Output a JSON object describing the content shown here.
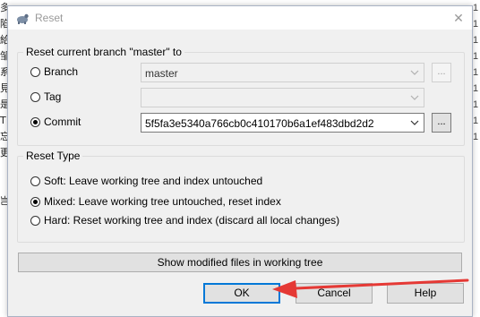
{
  "dialog": {
    "title": "Reset",
    "close_glyph": "✕",
    "app_icon": "tortoisegit-icon"
  },
  "branch_group": {
    "legend": "Reset current branch \"master\" to",
    "options": [
      {
        "label": "Branch",
        "selected": false
      },
      {
        "label": "Tag",
        "selected": false
      },
      {
        "label": "Commit",
        "selected": true
      }
    ],
    "branch_value": "master",
    "tag_value": "",
    "commit_value": "5f5fa3e5340a766cb0c410170b6a1ef483dbd2d2",
    "browse_label": "..."
  },
  "reset_type": {
    "legend": "Reset Type",
    "options": [
      {
        "label": "Soft: Leave working tree and index untouched",
        "selected": false
      },
      {
        "label": "Mixed: Leave working tree untouched, reset index",
        "selected": true
      },
      {
        "label": "Hard: Reset working tree and index (discard all local changes)",
        "selected": false
      }
    ]
  },
  "buttons": {
    "show_modified": "Show modified files in working tree",
    "ok": "OK",
    "cancel": "Cancel",
    "help": "Help"
  },
  "colors": {
    "accent": "#0078d7",
    "annotation_arrow": "#e53935"
  }
}
